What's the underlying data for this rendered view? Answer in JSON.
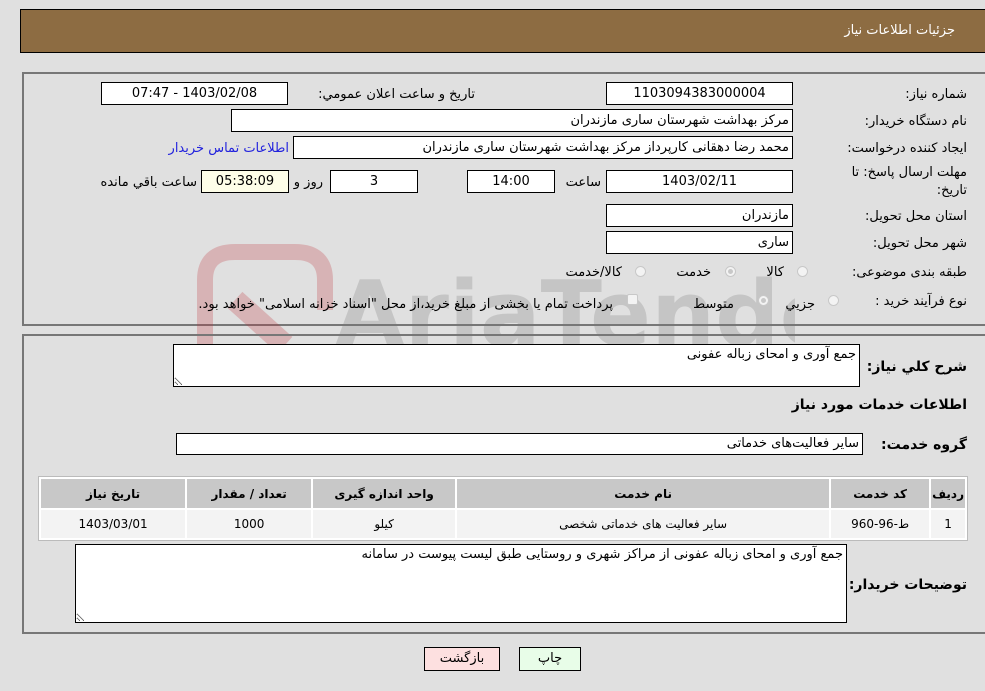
{
  "header": {
    "title": "جزئيات اطلاعات نياز"
  },
  "form": {
    "need_number": {
      "label": "شماره نياز:",
      "value": "1103094383000004"
    },
    "announce_datetime": {
      "label": "تاريخ و ساعت اعلان عمومي:",
      "value": "1403/02/08 - 07:47"
    },
    "buyer_org": {
      "label": "نام دستگاه خريدار:",
      "value": "مرکز بهداشت شهرستان ساری   مازندران"
    },
    "requester": {
      "label": "ايجاد کننده درخواست:",
      "value": "محمد رضا دهقانی کارپرداز  مرکز بهداشت شهرستان ساری   مازندران"
    },
    "buyer_contact_link": "اطلاعات تماس خريدار",
    "deadline": {
      "label": "مهلت ارسال پاسخ: تا تاريخ:",
      "date": "1403/02/11",
      "time_label": "ساعت",
      "time": "14:00",
      "days": "3",
      "days_label": "روز و",
      "remaining": "05:38:09",
      "remaining_label": "ساعت باقي مانده"
    },
    "delivery_province": {
      "label": "استان محل تحويل:",
      "value": "مازندران"
    },
    "delivery_city": {
      "label": "شهر محل تحويل:",
      "value": "ساری"
    },
    "category": {
      "label": "طبقه بندی موضوعی:",
      "options": [
        "کالا",
        "خدمت",
        "کالا/خدمت"
      ],
      "selected": "خدمت"
    },
    "process_type": {
      "label": "نوع فرآيند خريد :",
      "options": [
        "جزيي",
        "متوسط"
      ],
      "selected": "متوسط",
      "treasury_note": "پرداخت تمام يا بخشی از مبلغ خريد،از محل \"اسناد خزانه اسلامی\" خواهد بود."
    }
  },
  "details": {
    "summary_label": "شرح کلي نياز:",
    "summary_value": "جمع آوری و امحای زباله عفونی",
    "services_heading": "اطلاعات خدمات مورد نياز",
    "service_group_label": "گروه خدمت:",
    "service_group_value": "ساير فعاليت‌های خدماتی",
    "table": {
      "headers": [
        "رديف",
        "کد خدمت",
        "نام خدمت",
        "واحد اندازه گيری",
        "تعداد / مقدار",
        "تاريخ نياز"
      ],
      "rows": [
        [
          "1",
          "ط-96-960",
          "ساير فعاليت های خدماتی شخصی",
          "کيلو",
          "1000",
          "1403/03/01"
        ]
      ]
    },
    "buyer_notes_label": "توضيحات خريدار:",
    "buyer_notes_value": "جمع آوری و امحای زباله عفونی از مراکز شهری و روستايی طبق ليست پيوست در سامانه"
  },
  "buttons": {
    "print": "چاپ",
    "back": "بازگشت"
  },
  "watermark": {
    "text": "AriaTender.neT"
  }
}
